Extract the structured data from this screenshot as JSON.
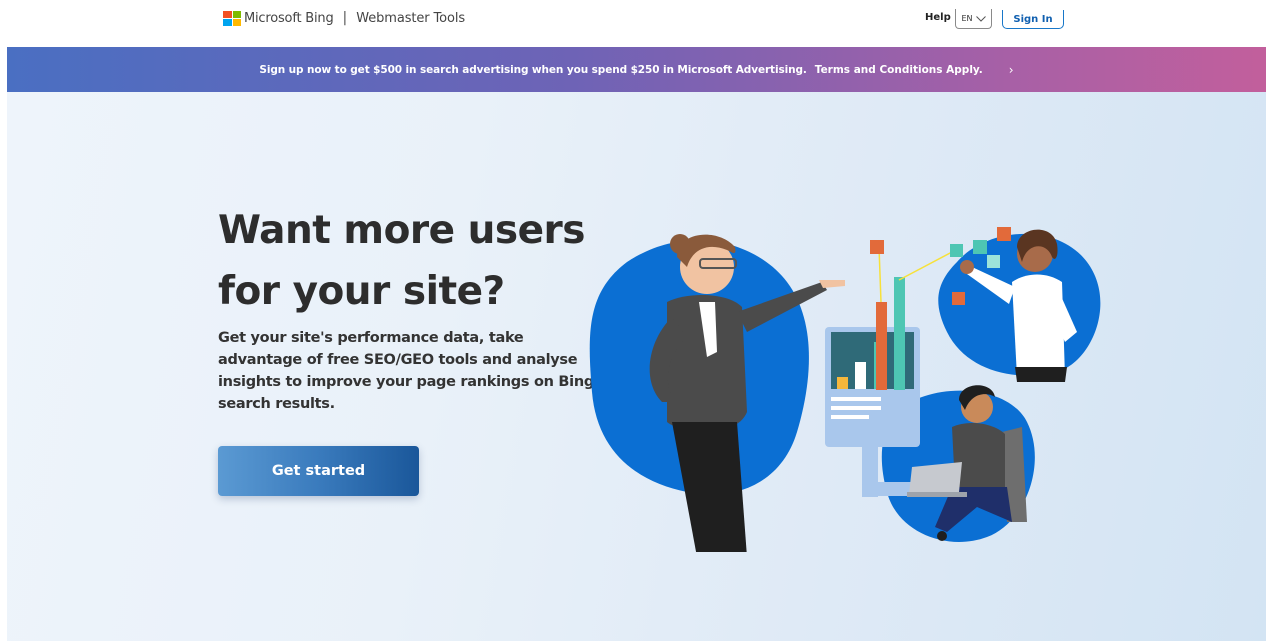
{
  "header": {
    "brand_name": "Microsoft Bing",
    "separator": "|",
    "product_name": "Webmaster Tools",
    "help_label": "Help",
    "language": "EN",
    "signin_label": "Sign In"
  },
  "promo": {
    "text": "Sign up now to get $500 in search advertising when you spend $250 in Microsoft Advertising.",
    "terms_label": "Terms and Conditions Apply.",
    "chevron": "›"
  },
  "hero": {
    "title_line1": "Want more users",
    "title_line2": "for your site?",
    "subtitle": "Get your site's performance data, take advantage of free SEO/GEO tools and analyse insights to improve your page rankings on Bing search results.",
    "cta_label": "Get started"
  },
  "colors": {
    "ms_red": "#f25022",
    "ms_green": "#7fba00",
    "ms_blue": "#00a4ef",
    "ms_yellow": "#ffb900",
    "accent_blue": "#1877c9",
    "blob_blue": "#0b6fd3"
  },
  "icons": {
    "logo": "microsoft-logo-icon",
    "lang": "chevron-down-icon",
    "promo": "chevron-right-icon"
  }
}
